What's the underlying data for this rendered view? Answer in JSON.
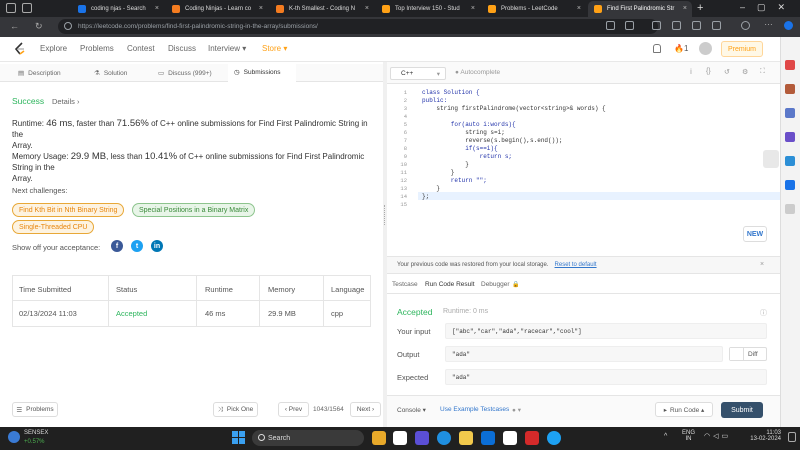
{
  "browser": {
    "tabs": [
      {
        "title": "coding njas - Search",
        "color": "#1a73e8"
      },
      {
        "title": "Coding Ninjas - Learn co",
        "color": "#f47c20"
      },
      {
        "title": "K-th Smallest - Coding N",
        "color": "#f47c20"
      },
      {
        "title": "Top Interview 150 - Stud",
        "color": "#ffa116"
      },
      {
        "title": "Problems - LeetCode",
        "color": "#ffa116"
      },
      {
        "title": "Find First Palindromic Str",
        "color": "#ffa116"
      }
    ],
    "new_tab": "+",
    "url": "https://leetcode.com/problems/find-first-palindromic-string-in-the-array/submissions/"
  },
  "site_nav": {
    "links": [
      "Explore",
      "Problems",
      "Contest",
      "Discuss",
      "Interview ▾",
      "Store ▾"
    ],
    "fire_count": "1",
    "premium": "Premium"
  },
  "left_tabs": [
    "Description",
    "Solution",
    "Discuss (999+)",
    "Submissions"
  ],
  "result": {
    "status": "Success",
    "details": "Details ›",
    "runtime_label": "Runtime:",
    "runtime_value": "46 ms",
    "runtime_mid": ", faster than",
    "runtime_pct": "71.56%",
    "runtime_tail_1": "of C++ online submissions for Find First Palindromic String in the",
    "runtime_tail_2": "Array.",
    "memory_label": "Memory Usage:",
    "memory_value": "29.9 MB",
    "memory_mid": ", less than",
    "memory_pct": "10.41%",
    "memory_tail_1": "of C++ online submissions for Find First Palindromic String in the",
    "memory_tail_2": "Array.",
    "next_challenges_label": "Next challenges:",
    "challenges": [
      "Find Kth Bit in Nth Binary String",
      "Special Positions in a Binary Matrix",
      "Single-Threaded CPU"
    ],
    "share_label": "Show off your acceptance:"
  },
  "table": {
    "headers": [
      "Time Submitted",
      "Status",
      "Runtime",
      "Memory",
      "Language"
    ],
    "rows": [
      [
        "02/13/2024 11:03",
        "Accepted",
        "46 ms",
        "29.9 MB",
        "cpp"
      ]
    ]
  },
  "left_footer": {
    "problems": "Problems",
    "pick_one": "Pick One",
    "prev": "‹ Prev",
    "counter": "1043/1564",
    "next": "Next ›"
  },
  "editor": {
    "language": "C++",
    "autocomplete": "Autocomplete",
    "line_numbers": [
      "1",
      "2",
      "3",
      "4",
      "5",
      "6",
      "7",
      "8",
      "9",
      "10",
      "11",
      "12",
      "13",
      "14",
      "15"
    ],
    "code_lines": [
      "class Solution {",
      "public:",
      "    string firstPalindrome(vector<string>& words) {",
      "",
      "        for(auto i:words){",
      "            string s=i;",
      "            reverse(s.begin(),s.end());",
      "            if(s==i){",
      "                return s;",
      "            }",
      "        }",
      "        return \"\";",
      "    }",
      "};",
      ""
    ],
    "new_label": "NEW"
  },
  "restore": {
    "message": "Your previous code was restored from your local storage.",
    "reset_link": "Reset to default"
  },
  "result_tabs": [
    "Testcase",
    "Run Code Result",
    "Debugger"
  ],
  "run_result": {
    "status": "Accepted",
    "runtime": "Runtime: 0 ms",
    "input_label": "Your input",
    "input_value": "[\"abc\",\"car\",\"ada\",\"racecar\",\"cool\"]",
    "output_label": "Output",
    "output_value": "\"ada\"",
    "diff": "Diff",
    "expected_label": "Expected",
    "expected_value": "\"ada\""
  },
  "bottom": {
    "console": "Console ▾",
    "use_example": "Use Example Testcases",
    "run_code": "Run Code ▴",
    "submit": "Submit"
  },
  "taskbar": {
    "sensex_label": "SENSEX",
    "sensex_value": "+0.57%",
    "search": "Search",
    "lang_1": "ENG",
    "lang_2": "IN",
    "time": "11:03",
    "date": "13-02-2024"
  }
}
